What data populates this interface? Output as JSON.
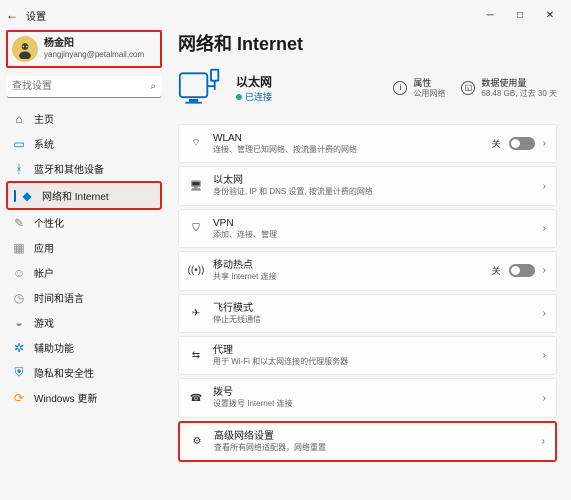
{
  "titlebar": {
    "back": "←",
    "title": "设置"
  },
  "user": {
    "name": "杨金阳",
    "email": "yangjinyang@petalmail.com"
  },
  "search": {
    "placeholder": "查找设置"
  },
  "nav": {
    "home": "主页",
    "system": "系统",
    "bt": "蓝牙和其他设备",
    "net": "网络和 Internet",
    "pers": "个性化",
    "apps": "应用",
    "acct": "帐户",
    "time": "时间和语言",
    "game": "游戏",
    "a11y": "辅助功能",
    "priv": "隐私和安全性",
    "upd": "Windows 更新"
  },
  "page": {
    "title": "网络和 Internet",
    "hero": {
      "title": "以太网",
      "status": "已连接"
    },
    "info1": {
      "title": "属性",
      "sub": "公用网络"
    },
    "info2": {
      "title": "数据使用量",
      "sub": "68.48 GB, 过去 30 天"
    }
  },
  "rows": {
    "wlan": {
      "title": "WLAN",
      "sub": "连接、管理已知网络、按流量计费的网络",
      "off": "关"
    },
    "eth": {
      "title": "以太网",
      "sub": "身份验证, IP 和 DNS 设置, 按流量计费的网络"
    },
    "vpn": {
      "title": "VPN",
      "sub": "添加、连接、管理"
    },
    "hotspot": {
      "title": "移动热点",
      "sub": "共享 Internet 连接",
      "off": "关"
    },
    "airplane": {
      "title": "飞行模式",
      "sub": "停止无线通信"
    },
    "proxy": {
      "title": "代理",
      "sub": "用于 Wi-Fi 和以太网连接的代理服务器"
    },
    "dialup": {
      "title": "拨号",
      "sub": "设置拨号 Internet 连接"
    },
    "adv": {
      "title": "高级网络设置",
      "sub": "查看所有网络适配器，网络重置"
    }
  }
}
